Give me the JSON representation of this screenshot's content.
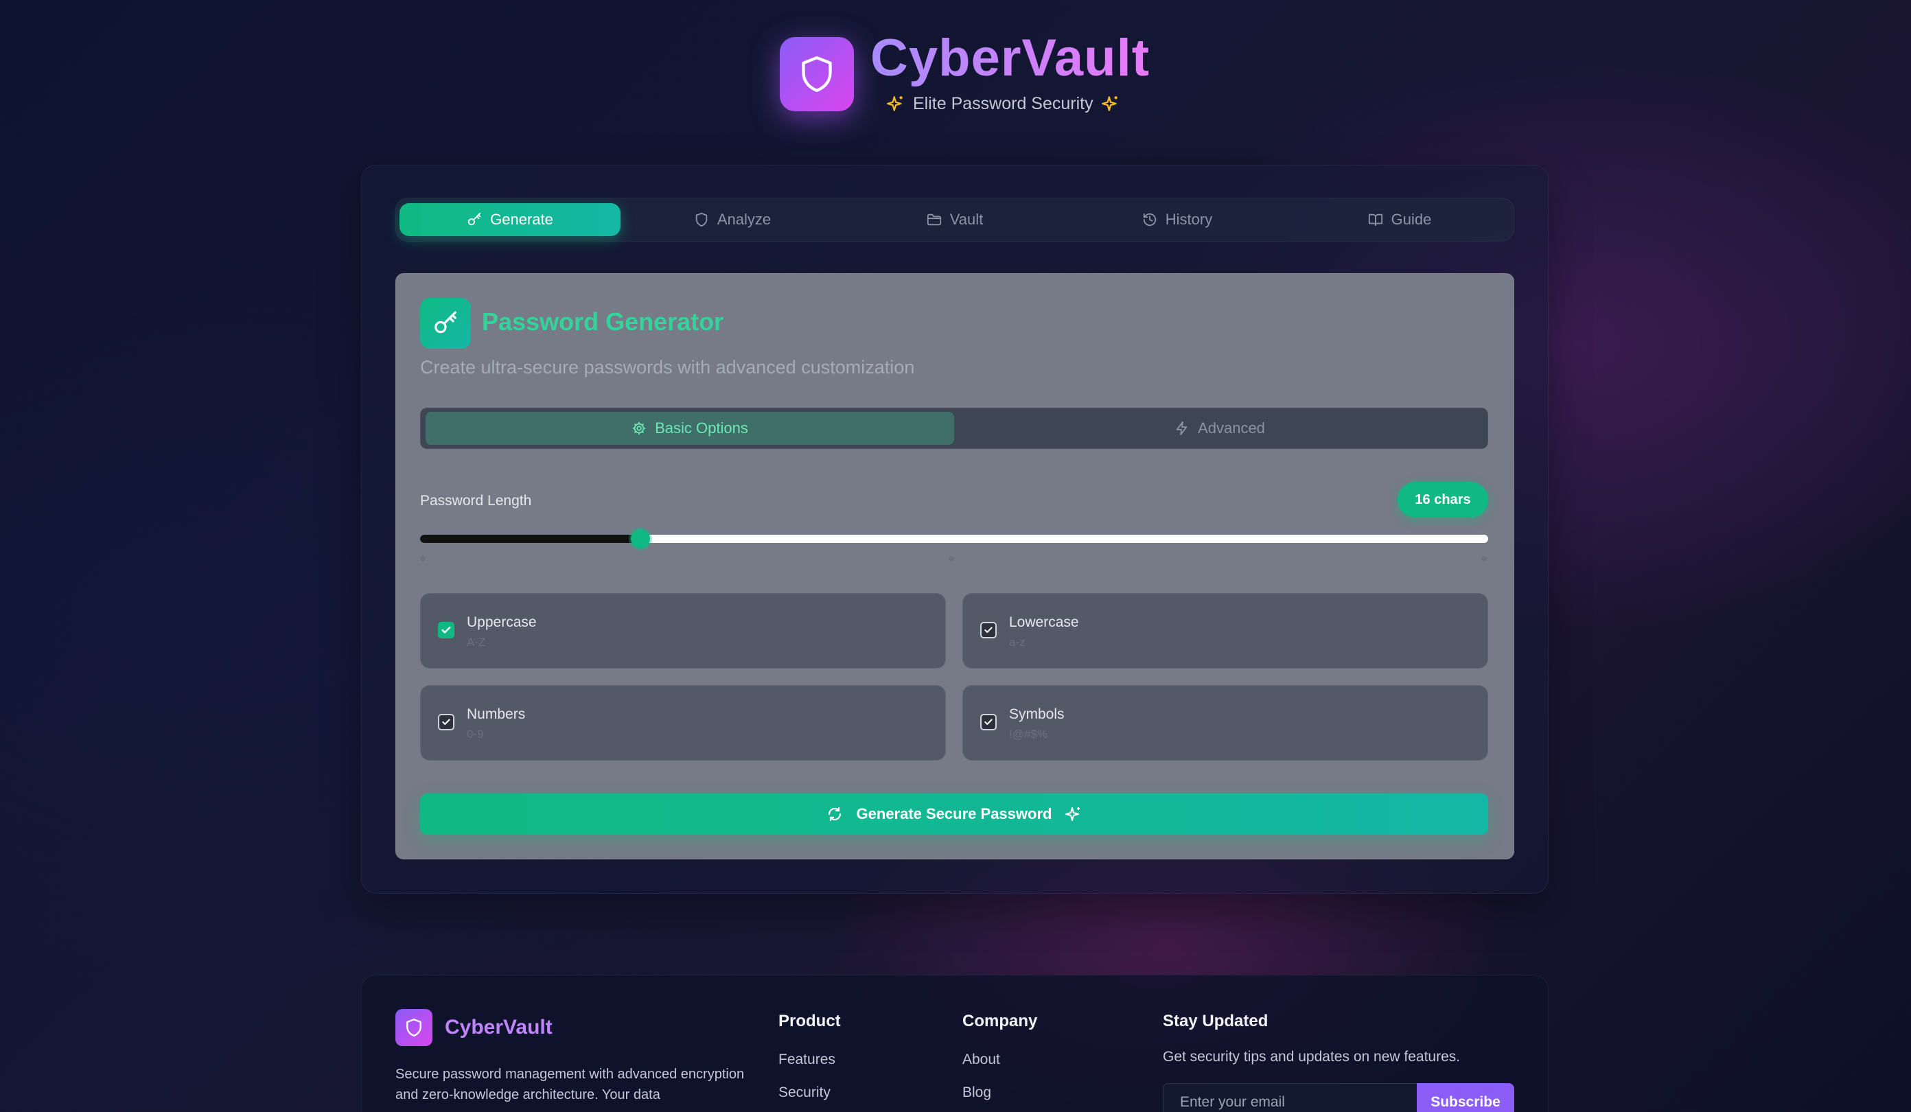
{
  "header": {
    "app_name": "CyberVault",
    "tagline": "Elite Password Security",
    "logo_icon": "shield-icon",
    "sparkle_icon": "sparkles-icon"
  },
  "tabs": [
    {
      "label": "Generate",
      "icon": "key-icon",
      "active": true
    },
    {
      "label": "Analyze",
      "icon": "shield-icon",
      "active": false
    },
    {
      "label": "Vault",
      "icon": "folder-icon",
      "active": false
    },
    {
      "label": "History",
      "icon": "history-icon",
      "active": false
    },
    {
      "label": "Guide",
      "icon": "book-icon",
      "active": false
    }
  ],
  "generator": {
    "title": "Password Generator",
    "description": "Create ultra-secure passwords with advanced customization",
    "subtabs": [
      {
        "label": "Basic Options",
        "icon": "gear-icon",
        "active": true
      },
      {
        "label": "Advanced",
        "icon": "lightning-icon",
        "active": false
      }
    ],
    "length_label": "Password Length",
    "length_badge": "16 chars",
    "length_value": 16,
    "length_fraction": 0.206,
    "options": [
      {
        "label": "Uppercase",
        "sub": "A-Z",
        "checked": true
      },
      {
        "label": "Lowercase",
        "sub": "a-z",
        "checked": true
      },
      {
        "label": "Numbers",
        "sub": "0-9",
        "checked": true
      },
      {
        "label": "Symbols",
        "sub": "!@#$%",
        "checked": true
      }
    ],
    "generate_button": "Generate Secure Password"
  },
  "footer": {
    "brand": "CyberVault",
    "description": "Secure password management with advanced encryption and zero-knowledge architecture. Your data",
    "product": {
      "heading": "Product",
      "links": [
        "Features",
        "Security"
      ]
    },
    "company": {
      "heading": "Company",
      "links": [
        "About",
        "Blog"
      ]
    },
    "newsletter": {
      "heading": "Stay Updated",
      "text": "Get security tips and updates on new features.",
      "placeholder": "Enter your email",
      "button": "Subscribe"
    }
  },
  "colors": {
    "accent_green": "#10b981",
    "accent_purple": "#8b5cf6",
    "accent_pink": "#d946ef",
    "sparkle_gold": "#fbbf24"
  }
}
